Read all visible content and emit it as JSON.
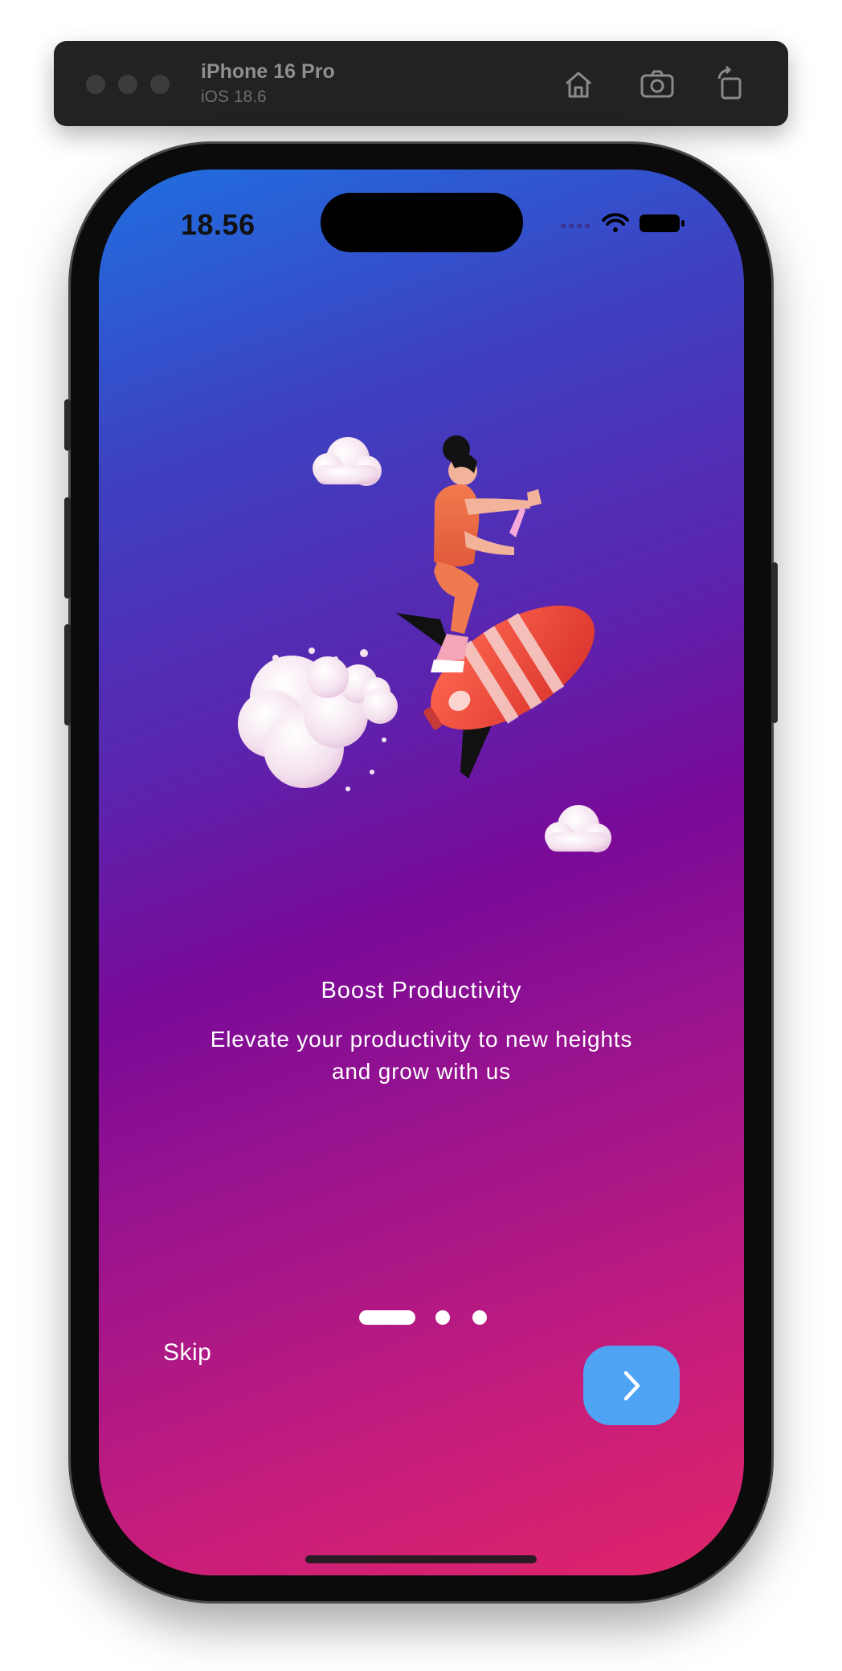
{
  "simulator": {
    "device_name": "iPhone 16 Pro",
    "os_version": "iOS 18.6",
    "icons": [
      "home-icon",
      "screenshot-icon",
      "rotate-icon"
    ]
  },
  "status_bar": {
    "time": "18.56",
    "icons": [
      "cellular-signal-icon",
      "wifi-icon",
      "battery-icon"
    ]
  },
  "onboarding": {
    "illustration": "woman-riding-rocket-illustration",
    "title": "Boost Productivity",
    "subtitle": "Elevate your productivity to new heights and grow with us",
    "page_indicator": {
      "pages": 3,
      "active": 1
    },
    "skip_label": "Skip",
    "next_icon": "chevron-right-icon"
  },
  "colors": {
    "gradient_start": "#1f6fe0",
    "gradient_mid": "#7a0a98",
    "gradient_end": "#e0256a",
    "next_button": "#4fa3f3",
    "text": "#ffffff"
  }
}
